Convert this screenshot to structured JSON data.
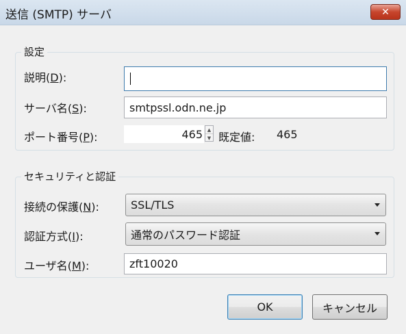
{
  "window": {
    "title": "送信 (SMTP) サーバ"
  },
  "settings_group": {
    "legend": "設定",
    "description": {
      "label": "説明(",
      "mnemonic": "D",
      "label_suffix": "):",
      "value": ""
    },
    "server_name": {
      "label": "サーバ名(",
      "mnemonic": "S",
      "label_suffix": "):",
      "value": "smtpssl.odn.ne.jp"
    },
    "port": {
      "label": "ポート番号(",
      "mnemonic": "P",
      "label_suffix": "):",
      "value": "465",
      "default_label": "既定値:",
      "default_value": "465"
    }
  },
  "security_group": {
    "legend": "セキュリティと認証",
    "connection_security": {
      "label": "接続の保護(",
      "mnemonic": "N",
      "label_suffix": "):",
      "value": "SSL/TLS"
    },
    "auth_method": {
      "label": "認証方式(",
      "mnemonic": "I",
      "label_suffix": "):",
      "value": "通常のパスワード認証"
    },
    "username": {
      "label": "ユーザ名(",
      "mnemonic": "M",
      "label_suffix": "):",
      "value": "zft10020"
    }
  },
  "buttons": {
    "ok": "OK",
    "cancel": "キャンセル"
  },
  "icons": {
    "close": "close-icon",
    "spin_up": "spin-up-icon",
    "spin_down": "spin-down-icon",
    "dropdown": "chevron-down-icon"
  },
  "colors": {
    "titlebar": "#c9d8e8",
    "close_button": "#c7452d",
    "focus_border": "#3d7bad",
    "background": "#f0f0f0"
  }
}
